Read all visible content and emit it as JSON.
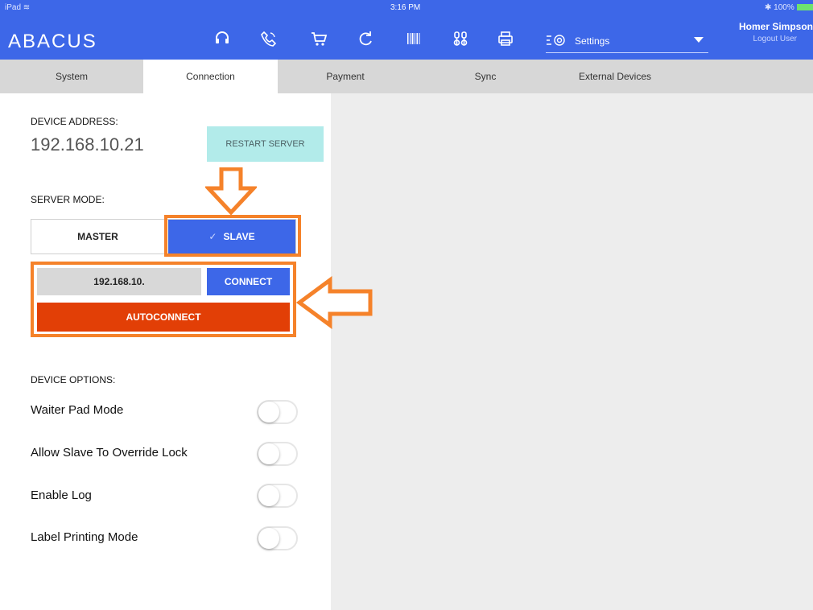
{
  "status_bar": {
    "device": "iPad",
    "time": "3:16 PM",
    "battery": "100%"
  },
  "header": {
    "brand": "ABACUS",
    "icons": [
      "headset-icon",
      "phone-icon",
      "cart-icon",
      "refresh-icon",
      "barcode-icon",
      "tools-icon",
      "printer-icon"
    ],
    "settings_label": "Settings",
    "user_name": "Homer Simpson",
    "logout_label": "Logout User"
  },
  "tabs": [
    {
      "label": "System"
    },
    {
      "label": "Connection",
      "active": true
    },
    {
      "label": "Payment"
    },
    {
      "label": "Sync"
    },
    {
      "label": "External Devices"
    }
  ],
  "connection": {
    "device_address_label": "DEVICE ADDRESS:",
    "device_address": "192.168.10.21",
    "restart_label": "RESTART SERVER",
    "server_mode_label": "SERVER MODE:",
    "mode_master": "MASTER",
    "mode_slave": "SLAVE",
    "selected_mode": "SLAVE",
    "ip_value": "192.168.10.",
    "connect_label": "CONNECT",
    "autoconnect_label": "AUTOCONNECT",
    "device_options_label": "DEVICE OPTIONS:",
    "options": [
      {
        "label": "Waiter Pad Mode",
        "on": false
      },
      {
        "label": "Allow Slave To Override Lock",
        "on": false
      },
      {
        "label": "Enable Log",
        "on": false
      },
      {
        "label": "Label Printing Mode",
        "on": false
      }
    ]
  },
  "colors": {
    "header_blue": "#3d67e8",
    "tab_bar": "#d7d7d7",
    "restart_bg": "#b2ebea",
    "autoconnect_red": "#e23f06",
    "highlight_orange": "#f5822a",
    "right_panel": "#ededed"
  }
}
